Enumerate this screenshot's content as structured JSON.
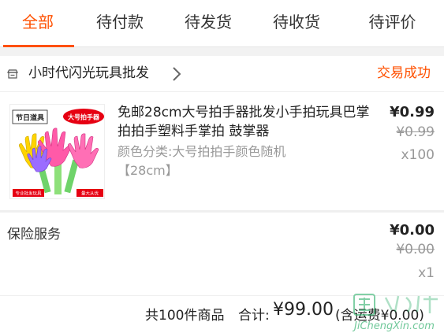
{
  "tabs": [
    {
      "label": "全部",
      "active": true
    },
    {
      "label": "待付款"
    },
    {
      "label": "待发货"
    },
    {
      "label": "待收货"
    },
    {
      "label": "待评价"
    }
  ],
  "shop": {
    "icon": "shop-icon",
    "name": "小时代闪光玩具批发",
    "status": "交易成功"
  },
  "product": {
    "thumb": {
      "badge_left": "节日道具",
      "badge_right": "大号拍手器",
      "caption_left": "专业批发玩具",
      "caption_right": "量大从优"
    },
    "title": "免邮28cm大号拍手器批发小手拍玩具巴掌拍拍手塑料手掌拍 鼓掌器",
    "sku": "颜色分类:大号拍拍手颜色随机【28cm】",
    "price": "¥0.99",
    "original_price": "¥0.99",
    "quantity": "x100"
  },
  "insurance": {
    "label": "保险服务",
    "price": "¥0.00",
    "original_price": "¥0.00",
    "quantity": "x1"
  },
  "summary": {
    "count": "共100件商品",
    "total_label": "合计:",
    "total": "¥99.00",
    "shipping": "(含运费¥0.00)"
  },
  "watermark": {
    "text": "JiChengXin.com"
  },
  "colors": {
    "accent": "#ff5000",
    "muted": "#999999",
    "text": "#222222"
  }
}
